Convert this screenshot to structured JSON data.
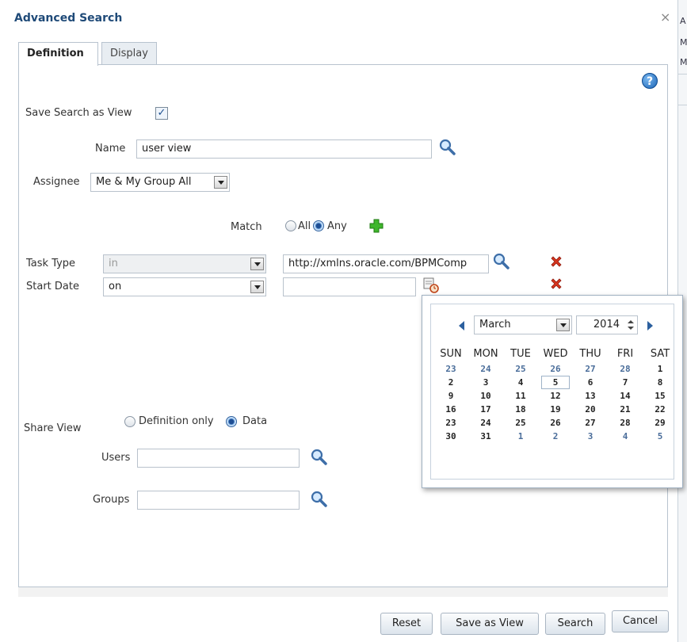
{
  "dialog": {
    "title": "Advanced Search",
    "close": "×"
  },
  "background_app": {
    "text_1": "A",
    "text_2": "M",
    "text_3": "M"
  },
  "tabs": [
    {
      "label": "Definition"
    },
    {
      "label": "Display"
    }
  ],
  "help": "?",
  "save_search": {
    "label": "Save Search as View",
    "checked": true
  },
  "name": {
    "label": "Name",
    "value": "user view"
  },
  "assignee": {
    "label": "Assignee",
    "value": "Me & My Group All"
  },
  "match": {
    "label": "Match",
    "option_all": "All",
    "option_any": "Any",
    "selected": "Any"
  },
  "conditions": [
    {
      "field": "Task Type",
      "operator": "in",
      "value": "http://xmlns.oracle.com/BPMComp"
    },
    {
      "field": "Start Date",
      "operator": "on",
      "value": ""
    }
  ],
  "share_view": {
    "label": "Share View",
    "option_definition": "Definition only",
    "option_data": "Data",
    "selected": "Data"
  },
  "users": {
    "label": "Users",
    "value": ""
  },
  "groups": {
    "label": "Groups",
    "value": ""
  },
  "calendar": {
    "month": "March",
    "year": "2014",
    "weekdays": [
      "SUN",
      "MON",
      "TUE",
      "WED",
      "THU",
      "FRI",
      "SAT"
    ],
    "weeks": [
      [
        "23",
        "24",
        "25",
        "26",
        "27",
        "28",
        "1"
      ],
      [
        "2",
        "3",
        "4",
        "5",
        "6",
        "7",
        "8"
      ],
      [
        "9",
        "10",
        "11",
        "12",
        "13",
        "14",
        "15"
      ],
      [
        "16",
        "17",
        "18",
        "19",
        "20",
        "21",
        "22"
      ],
      [
        "23",
        "24",
        "25",
        "26",
        "27",
        "28",
        "29"
      ],
      [
        "30",
        "31",
        "1",
        "2",
        "3",
        "4",
        "5"
      ]
    ],
    "selected_day": "5"
  },
  "buttons": {
    "reset": "Reset",
    "save_as_view": "Save as View",
    "search": "Search",
    "cancel": "Cancel"
  }
}
